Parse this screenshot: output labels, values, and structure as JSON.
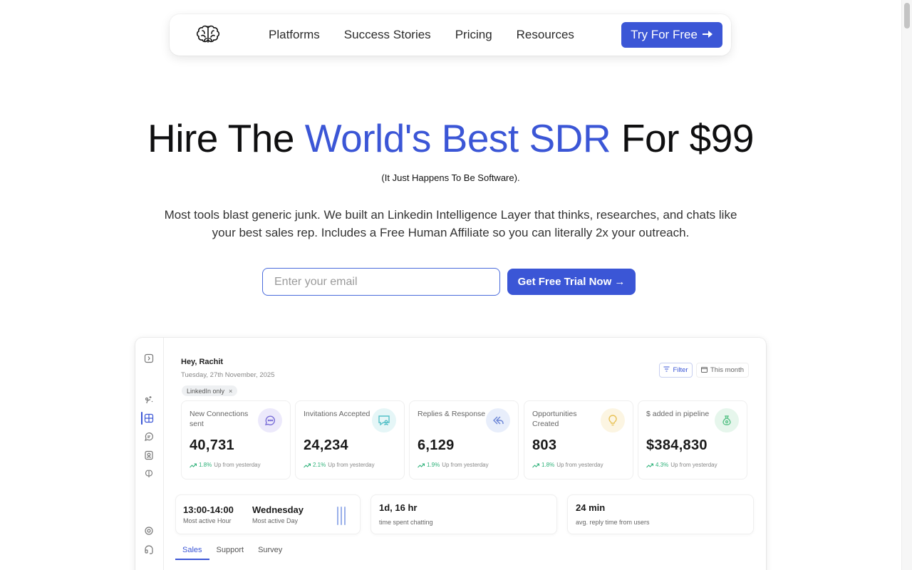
{
  "nav": {
    "logo": "brain-logo",
    "links": [
      "Platforms",
      "Success Stories",
      "Pricing",
      "Resources"
    ],
    "cta_label": "Try For Free",
    "cta_icon": "arrow-right-icon"
  },
  "hero": {
    "title_pre": "Hire The",
    "title_accent": "World's Best SDR",
    "title_post": "For $99",
    "subtitle": "(It Just Happens To Be Software).",
    "description": "Most tools blast generic junk. We built an Linkedin Intelligence Layer that thinks, researches, and chats like your best sales rep. Includes a Free Human Affiliate so you can literally 2x your outreach.",
    "email_placeholder": "Enter your email",
    "trial_label": "Get Free Trial Now →",
    "accent_color": "#3b56d6"
  },
  "dashboard": {
    "greeting": "Hey, Rachit",
    "date": "Tuesday, 27th November, 2025",
    "chip": "LinkedIn only",
    "chip_close": "×",
    "filter_label": "Filter",
    "month_label": "This month",
    "stats": [
      {
        "label": "New Connections sent",
        "value": "40,731",
        "pct": "1.8%",
        "trend": "Up from yesterday",
        "icon": "chat-bubble-icon",
        "icon_bg": "#ece9fb",
        "icon_color": "#7b6fd8"
      },
      {
        "label": "Invitations Accepted",
        "value": "24,234",
        "pct": "2.1%",
        "trend": "Up from yesterday",
        "icon": "message-user-icon",
        "icon_bg": "#e5f6f7",
        "icon_color": "#55c1c8"
      },
      {
        "label": "Replies & Response",
        "value": "6,129",
        "pct": "1.9%",
        "trend": "Up from yesterday",
        "icon": "reply-icon",
        "icon_bg": "#e8eefb",
        "icon_color": "#6a84d6"
      },
      {
        "label": "Opportunities Created",
        "value": "803",
        "pct": "1.8%",
        "trend": "Up from yesterday",
        "icon": "lightbulb-icon",
        "icon_bg": "#fcf5e2",
        "icon_color": "#e8c35a"
      },
      {
        "label": "$ added in pipeline",
        "value": "$384,830",
        "pct": "4.3%",
        "trend": "Up from yesterday",
        "icon": "money-bag-icon",
        "icon_bg": "#e6f6ec",
        "icon_color": "#5cc48a"
      }
    ],
    "activity": {
      "hour": "13:00-14:00",
      "hour_label": "Most active Hour",
      "day": "Wednesday",
      "day_label": "Most active Day"
    },
    "chatting": {
      "value": "1d, 16 hr",
      "label": "time spent chatting"
    },
    "reply": {
      "value": "24 min",
      "label": "avg. reply time from users"
    },
    "tabs": [
      "Sales",
      "Support",
      "Survey"
    ],
    "active_tab": "Sales"
  }
}
